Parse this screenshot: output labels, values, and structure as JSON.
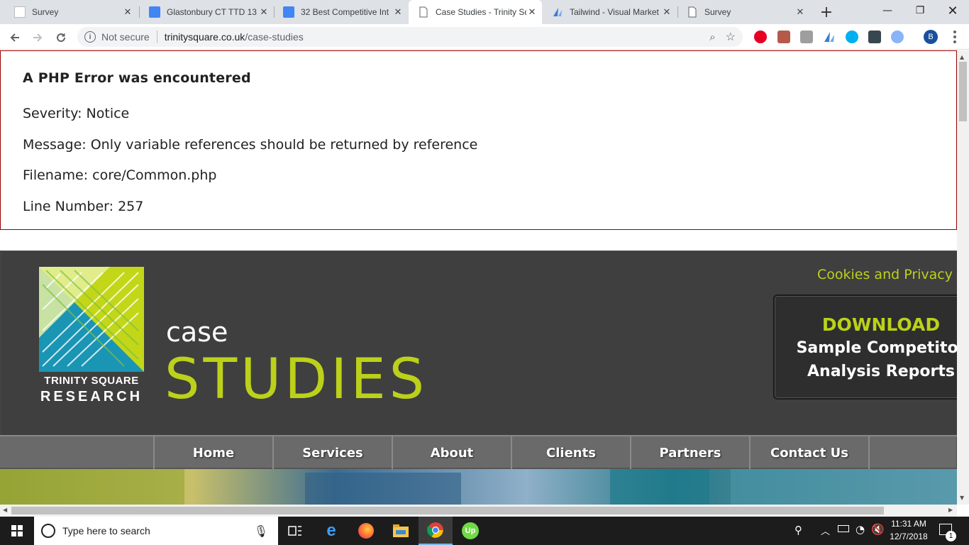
{
  "browser": {
    "tabs": [
      {
        "title": "Survey",
        "icon": "page-icon"
      },
      {
        "title": "Glastonbury CT TTD 13",
        "icon": "google-docs-icon"
      },
      {
        "title": "32 Best Competitive Int",
        "icon": "google-docs-icon"
      },
      {
        "title": "Case Studies - Trinity Sq",
        "icon": "page-icon",
        "active": true
      },
      {
        "title": "Tailwind - Visual Market",
        "icon": "tailwind-icon"
      },
      {
        "title": "Survey",
        "icon": "page-icon"
      }
    ],
    "security_label": "Not secure",
    "url_domain": "trinitysquare.co.uk",
    "url_path": "/case-studies",
    "profile_initial": "B"
  },
  "error": {
    "heading": "A PHP Error was encountered",
    "severity": "Severity: Notice",
    "message": "Message: Only variable references should be returned by reference",
    "filename": "Filename: core/Common.php",
    "line": "Line Number: 257"
  },
  "site": {
    "logo_line1": "TRINITY SQUARE",
    "logo_line2": "RESEARCH",
    "title_small": "case",
    "title_large": "STUDIES",
    "cookies_link": "Cookies and Privacy Po",
    "download_line1": "DOWNLOAD",
    "download_line2": "Sample Competitor",
    "download_line3": "Analysis Reports",
    "nav": [
      "Home",
      "Services",
      "About",
      "Clients",
      "Partners",
      "Contact Us"
    ],
    "accent_color": "#bcd11a"
  },
  "taskbar": {
    "search_placeholder": "Type here to search",
    "time": "11:31 AM",
    "date": "12/7/2018",
    "notification_count": "1"
  }
}
